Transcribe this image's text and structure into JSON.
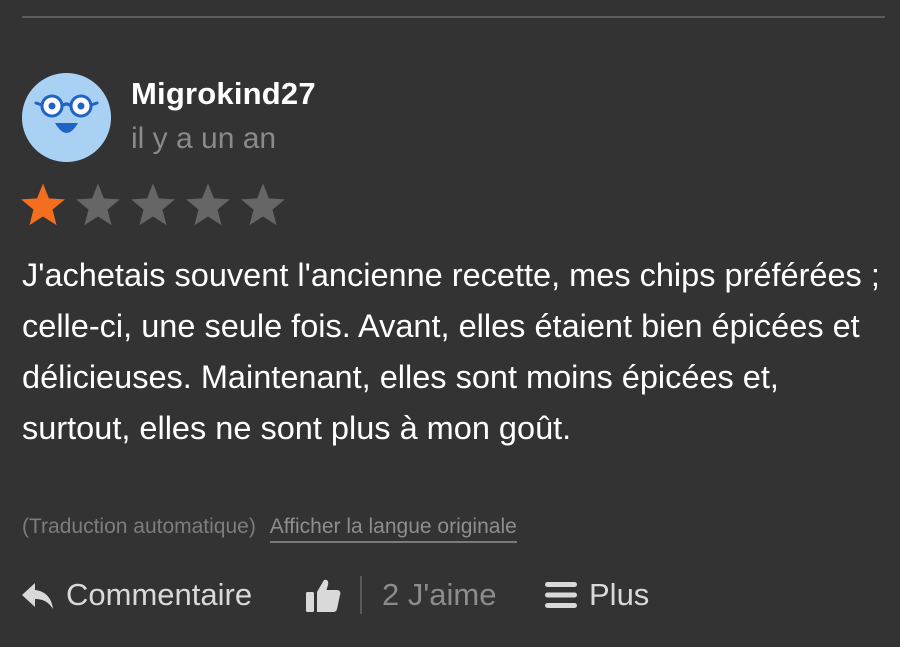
{
  "review": {
    "author": "Migrokind27",
    "time": "il y a un an",
    "rating": 1,
    "rating_max": 5,
    "star_filled_color": "#f36f1f",
    "star_empty_color": "#666666",
    "text": "J'achetais souvent l'ancienne recette, mes chips préférées ; celle-ci, une seule fois. Avant, elles étaient bien épicées et délicieuses. Maintenant, elles sont moins épicées et, surtout, elles ne sont plus à mon goût.",
    "translation_note": "(Traduction automatique)",
    "show_original_label": "Afficher la langue originale"
  },
  "actions": {
    "comment_label": "Commentaire",
    "comment_icon": "reply-icon",
    "like_icon": "thumbs-up-icon",
    "likes_label": "2 J'aime",
    "more_label": "Plus",
    "more_icon": "menu-icon"
  },
  "avatar": {
    "icon": "smiley-glasses-avatar",
    "background": "#a9d1f3"
  }
}
